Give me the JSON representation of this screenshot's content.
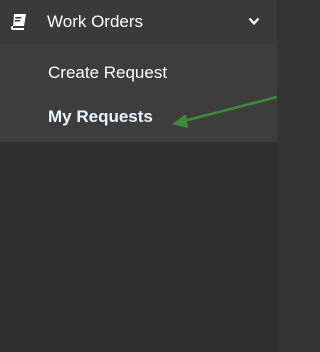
{
  "menu": {
    "title": "Work Orders",
    "header_icon": "book-icon",
    "toggle_icon": "chevron-down-icon",
    "items": [
      {
        "label": "Create Request"
      },
      {
        "label": "My Requests",
        "active": true
      }
    ]
  },
  "annotation": {
    "arrow_color": "#3e8a3a"
  },
  "colors": {
    "sidebar_bg": "#333333",
    "submenu_bg": "#3d3d3d",
    "active_text": "#e9f6ff",
    "text": "#ffffff"
  }
}
